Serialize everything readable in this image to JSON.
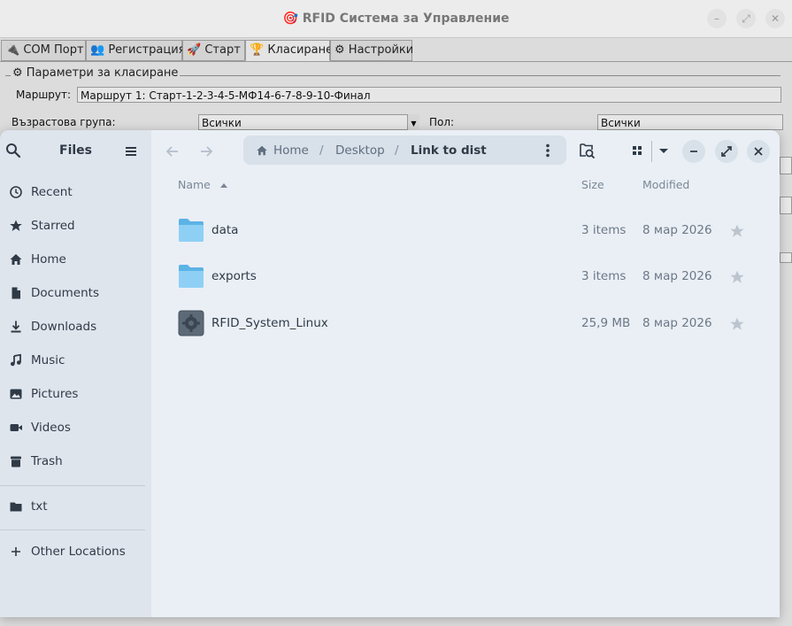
{
  "bg_app": {
    "title": "RFID Система за Управление",
    "title_icon": "🎯",
    "tabs": [
      {
        "icon": "🔌",
        "label": "COM Порт"
      },
      {
        "icon": "👥",
        "label": "Регистрация"
      },
      {
        "icon": "🚀",
        "label": "Старт"
      },
      {
        "icon": "🏆",
        "label": "Класиране"
      },
      {
        "icon": "⚙",
        "label": "Настройки"
      }
    ],
    "group_title": "⚙ Параметри за класиране",
    "route_label": "Маршрут:",
    "route_value": "Маршрут 1: Старт-1-2-3-4-5-МФ14-6-7-8-9-10-Финал",
    "age_label": "Възрастова група:",
    "age_value": "Всички",
    "gender_label": "Пол:",
    "gender_value": "Всички"
  },
  "files": {
    "sidebar": {
      "title": "Files",
      "items": [
        {
          "icon": "clock-icon",
          "label": "Recent"
        },
        {
          "icon": "star-icon",
          "label": "Starred"
        },
        {
          "icon": "home-icon",
          "label": "Home"
        },
        {
          "icon": "document-icon",
          "label": "Documents"
        },
        {
          "icon": "download-icon",
          "label": "Downloads"
        },
        {
          "icon": "music-icon",
          "label": "Music"
        },
        {
          "icon": "picture-icon",
          "label": "Pictures"
        },
        {
          "icon": "video-icon",
          "label": "Videos"
        },
        {
          "icon": "trash-icon",
          "label": "Trash"
        }
      ],
      "bookmarks": [
        {
          "icon": "folder-icon",
          "label": "txt"
        }
      ],
      "other_locations": "Other Locations"
    },
    "pathbar": {
      "crumbs": [
        "Home",
        "Desktop",
        "Link to dist"
      ],
      "separator": "/"
    },
    "columns": {
      "name": "Name",
      "size": "Size",
      "modified": "Modified"
    },
    "rows": [
      {
        "icon": "folder-icon",
        "name": "data",
        "size": "3 items",
        "modified": "8 мар 2026"
      },
      {
        "icon": "folder-icon",
        "name": "exports",
        "size": "3 items",
        "modified": "8 мар 2026"
      },
      {
        "icon": "executable-icon",
        "name": "RFID_System_Linux",
        "size": "25,9 MB",
        "modified": "8 мар 2026"
      }
    ],
    "colors": {
      "sidebar_bg": "#dfe5ec",
      "main_bg": "#eaeff5",
      "folder": "#7cc4ee",
      "text": "#2f3a47"
    }
  }
}
